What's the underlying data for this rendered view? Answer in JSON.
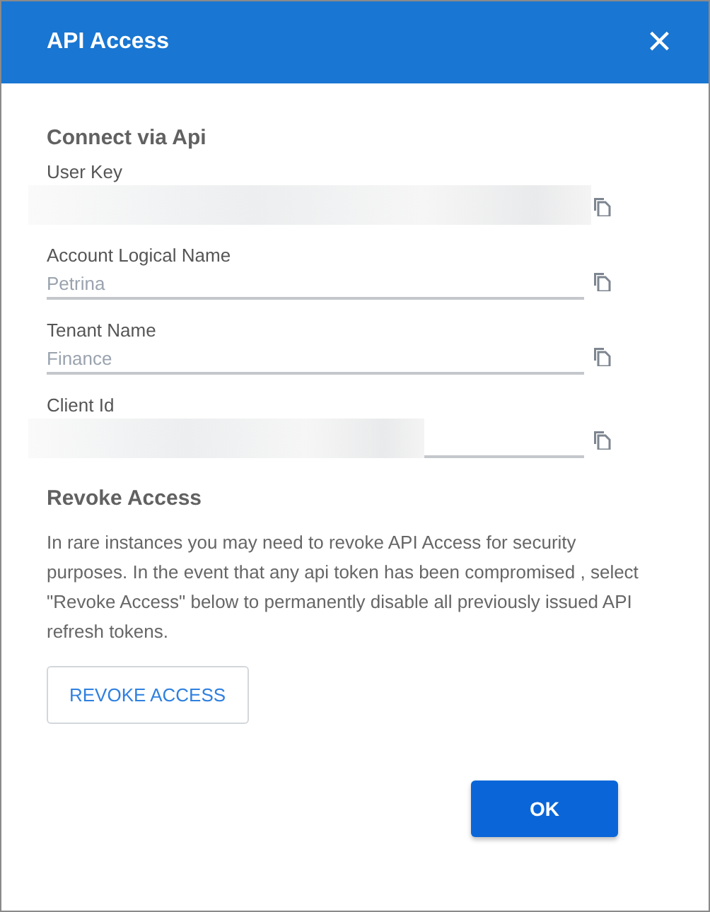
{
  "dialog": {
    "title": "API Access",
    "close_icon": "×"
  },
  "connect": {
    "heading": "Connect via Api",
    "fields": [
      {
        "label": "User Key",
        "kind": "redacted"
      },
      {
        "label": "Account Logical Name",
        "kind": "text",
        "value": "Petrina"
      },
      {
        "label": "Tenant Name",
        "kind": "text",
        "value": "Finance"
      },
      {
        "label": "Client Id",
        "kind": "redacted"
      }
    ]
  },
  "revoke": {
    "heading": "Revoke Access",
    "text": "In rare instances you may need to revoke API Access for security purposes. In the event that any api token has been compromised , select \"Revoke Access\" below to permanently disable all previously issued API refresh tokens.",
    "button": "REVOKE ACCESS"
  },
  "buttons": [
    "OK"
  ]
}
